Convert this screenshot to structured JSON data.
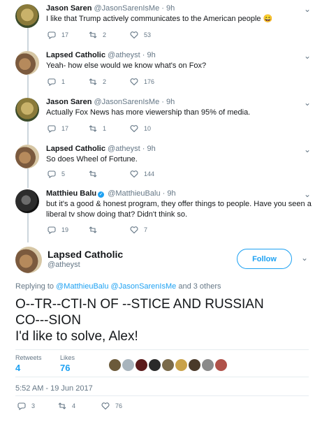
{
  "replies": [
    {
      "avatar": "jason-avatar",
      "name": "Jason Saren",
      "handle": "@JasonSarenIsMe",
      "time": "9h",
      "text": "I like that Trump actively communicates to the American people 😄",
      "replies": "17",
      "retweets": "2",
      "likes": "53"
    },
    {
      "avatar": "catholic-avatar",
      "name": "Lapsed Catholic",
      "handle": "@atheyst",
      "time": "9h",
      "text": "Yeah- how else would we know what's on Fox?",
      "replies": "1",
      "retweets": "2",
      "likes": "176"
    },
    {
      "avatar": "jason-avatar",
      "name": "Jason Saren",
      "handle": "@JasonSarenIsMe",
      "time": "9h",
      "text": "Actually Fox News has more viewership than 95% of media.",
      "replies": "17",
      "retweets": "1",
      "likes": "10"
    },
    {
      "avatar": "catholic-avatar",
      "name": "Lapsed Catholic",
      "handle": "@atheyst",
      "time": "9h",
      "text": "So does Wheel of Fortune.",
      "replies": "5",
      "retweets": "",
      "likes": "144"
    },
    {
      "avatar": "balu-avatar",
      "name": "Matthieu Balu",
      "handle": "@MatthieuBalu",
      "time": "9h",
      "text": "but it's a good & honest program, they offer things to people. Have you seen a liberal tv show doing that? Didn't think so.",
      "replies": "19",
      "retweets": "",
      "likes": "7"
    }
  ],
  "main": {
    "name": "Lapsed Catholic",
    "handle": "@atheyst",
    "follow_label": "Follow",
    "replying_prefix": "Replying to",
    "replying_user1": "@MatthieuBalu",
    "replying_user2": "@JasonSarenIsMe",
    "replying_suffix": "and 3 others",
    "text_line1": "O--TR--CTI-N OF --STICE AND RUSSIAN",
    "text_line2": "CO---SION",
    "text_line3": "I'd like to solve, Alex!",
    "retweets_label": "Retweets",
    "retweets_value": "4",
    "likes_label": "Likes",
    "likes_value": "76",
    "timestamp": "5:52 AM - 19 Jun 2017",
    "reply_count": "3",
    "retweet_count": "4",
    "like_count": "76"
  },
  "colors": {
    "accent": "#1da1f2",
    "muted": "#657786",
    "divider": "#e6ecf0"
  },
  "icons": [
    "reply-icon",
    "retweet-icon",
    "heart-icon",
    "chevron-down-icon",
    "verified-icon"
  ]
}
